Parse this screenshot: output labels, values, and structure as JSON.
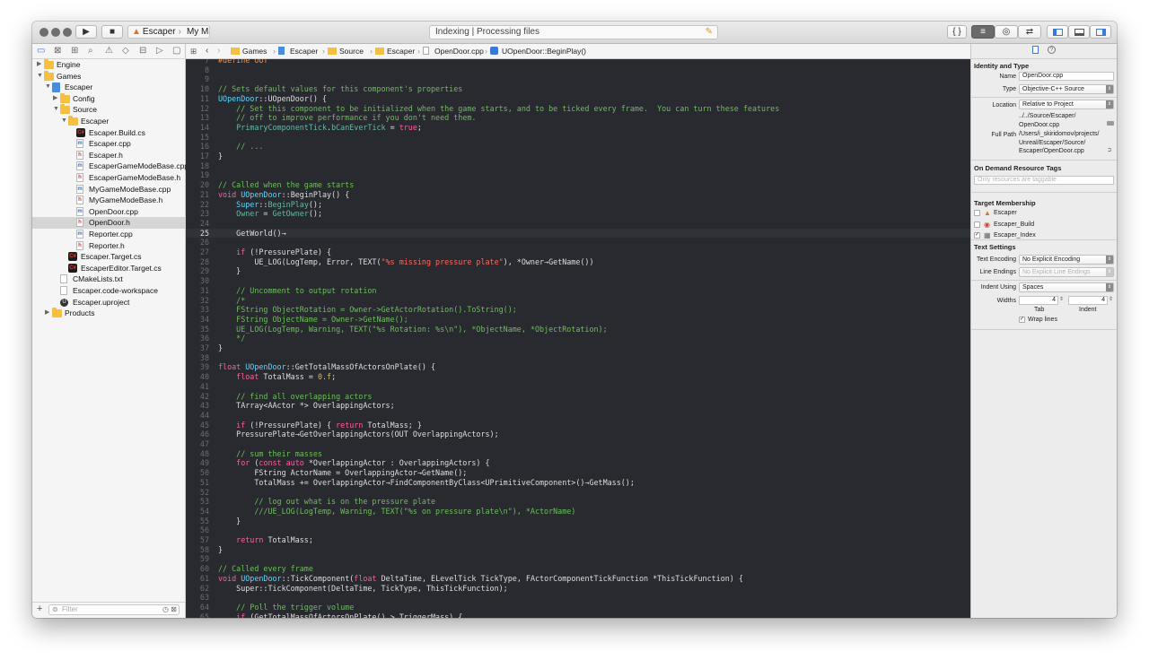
{
  "toolbar": {
    "scheme": "Escaper",
    "destination": "My Mac",
    "activity": "Indexing | Processing files"
  },
  "navigator": {
    "filter_placeholder": "Filter",
    "items": [
      {
        "label": "Engine",
        "depth": 0,
        "kind": "folder",
        "disclosure": "▶"
      },
      {
        "label": "Games",
        "depth": 0,
        "kind": "folder",
        "disclosure": "▼"
      },
      {
        "label": "Escaper",
        "depth": 1,
        "kind": "project",
        "disclosure": "▼"
      },
      {
        "label": "Config",
        "depth": 2,
        "kind": "folder",
        "disclosure": "▶"
      },
      {
        "label": "Source",
        "depth": 2,
        "kind": "folder",
        "disclosure": "▼"
      },
      {
        "label": "Escaper",
        "depth": 3,
        "kind": "folder",
        "disclosure": "▼"
      },
      {
        "label": "Escaper.Build.cs",
        "depth": 4,
        "kind": "badge",
        "badge": "C#"
      },
      {
        "label": "Escaper.cpp",
        "depth": 4,
        "kind": "doc",
        "type": "m",
        "letter": "m"
      },
      {
        "label": "Escaper.h",
        "depth": 4,
        "kind": "doc",
        "type": "h",
        "letter": "h"
      },
      {
        "label": "EscaperGameModeBase.cpp",
        "depth": 4,
        "kind": "doc",
        "type": "m",
        "letter": "m"
      },
      {
        "label": "EscaperGameModeBase.h",
        "depth": 4,
        "kind": "doc",
        "type": "h",
        "letter": "h"
      },
      {
        "label": "MyGameModeBase.cpp",
        "depth": 4,
        "kind": "doc",
        "type": "m",
        "letter": "m"
      },
      {
        "label": "MyGameModeBase.h",
        "depth": 4,
        "kind": "doc",
        "type": "h",
        "letter": "h"
      },
      {
        "label": "OpenDoor.cpp",
        "depth": 4,
        "kind": "doc",
        "type": "m",
        "letter": "m"
      },
      {
        "label": "OpenDoor.h",
        "depth": 4,
        "kind": "doc",
        "type": "h",
        "letter": "h",
        "selected": true
      },
      {
        "label": "Reporter.cpp",
        "depth": 4,
        "kind": "doc",
        "type": "m",
        "letter": "m"
      },
      {
        "label": "Reporter.h",
        "depth": 4,
        "kind": "doc",
        "type": "h",
        "letter": "h"
      },
      {
        "label": "Escaper.Target.cs",
        "depth": 3,
        "kind": "badge",
        "badge": "C#"
      },
      {
        "label": "EscaperEditor.Target.cs",
        "depth": 3,
        "kind": "badge",
        "badge": "C#"
      },
      {
        "label": "CMakeLists.txt",
        "depth": 2,
        "kind": "doc",
        "type": "g",
        "letter": ""
      },
      {
        "label": "Escaper.code-workspace",
        "depth": 2,
        "kind": "doc",
        "type": "g",
        "letter": ""
      },
      {
        "label": "Escaper.uproject",
        "depth": 2,
        "kind": "uproj"
      },
      {
        "label": "Products",
        "depth": 1,
        "kind": "folder",
        "disclosure": "▶"
      }
    ]
  },
  "jumpbar": [
    "Games",
    "Escaper",
    "Source",
    "Escaper",
    "OpenDoor.cpp",
    "UOpenDoor::BeginPlay()"
  ],
  "colors": {
    "comment": "#6bbf59",
    "keyword": "#fc5fa3",
    "type": "#5dd8ff",
    "macro": "#fd8f3f",
    "string": "#fc6a5d",
    "func": "#67b7a4",
    "plain": "#dfdfe0",
    "number": "#d0bf69",
    "linenum": "#6c6c73"
  },
  "code": [
    {
      "n": "7",
      "t": [
        [
          "#define OUT",
          "macro"
        ]
      ]
    },
    {
      "n": "8",
      "t": []
    },
    {
      "n": "9",
      "t": []
    },
    {
      "n": "10",
      "t": [
        [
          "// Sets default values for this component's properties",
          "comment"
        ]
      ]
    },
    {
      "n": "11",
      "t": [
        [
          "UOpenDoor",
          "type"
        ],
        [
          "::",
          "plain"
        ],
        [
          "UOpenDoor() {",
          "plain"
        ]
      ]
    },
    {
      "n": "12",
      "t": [
        [
          "    // Set this component to be initialized when the game starts, and to be ticked every frame.  You can turn these features",
          "comment"
        ]
      ]
    },
    {
      "n": "13",
      "t": [
        [
          "    // off to improve performance if you don't need them.",
          "comment"
        ]
      ]
    },
    {
      "n": "14",
      "t": [
        [
          "    PrimaryComponentTick",
          "func"
        ],
        [
          ".",
          "plain"
        ],
        [
          "bCanEverTick",
          "func"
        ],
        [
          " = ",
          "plain"
        ],
        [
          "true",
          "keyword"
        ],
        [
          ";",
          "plain"
        ]
      ]
    },
    {
      "n": "15",
      "t": []
    },
    {
      "n": "16",
      "t": [
        [
          "    // ...",
          "comment"
        ]
      ]
    },
    {
      "n": "17",
      "t": [
        [
          "}",
          "plain"
        ]
      ]
    },
    {
      "n": "18",
      "t": []
    },
    {
      "n": "19",
      "t": []
    },
    {
      "n": "20",
      "t": [
        [
          "// Called when the game starts",
          "comment"
        ]
      ]
    },
    {
      "n": "21",
      "t": [
        [
          "void ",
          "keyword"
        ],
        [
          "UOpenDoor",
          "type"
        ],
        [
          "::",
          "plain"
        ],
        [
          "BeginPlay() {",
          "plain"
        ]
      ]
    },
    {
      "n": "22",
      "t": [
        [
          "    Super",
          "type"
        ],
        [
          "::",
          "plain"
        ],
        [
          "BeginPlay",
          "func"
        ],
        [
          "();",
          "plain"
        ]
      ]
    },
    {
      "n": "23",
      "t": [
        [
          "    Owner",
          "func"
        ],
        [
          " = ",
          "plain"
        ],
        [
          "GetOwner",
          "func"
        ],
        [
          "();",
          "plain"
        ]
      ]
    },
    {
      "n": "24",
      "t": []
    },
    {
      "n": "25",
      "t": [
        [
          "    GetWorld()→",
          "plain"
        ]
      ],
      "current": true
    },
    {
      "n": "26",
      "t": []
    },
    {
      "n": "27",
      "t": [
        [
          "    if ",
          "keyword"
        ],
        [
          "(!PressurePlate) {",
          "plain"
        ]
      ]
    },
    {
      "n": "28",
      "t": [
        [
          "        UE_LOG(LogTemp, Error, TEXT(",
          "plain"
        ],
        [
          "\"%s missing pressure plate\"",
          "string"
        ],
        [
          "), *Owner→GetName())",
          "plain"
        ]
      ]
    },
    {
      "n": "29",
      "t": [
        [
          "    }",
          "plain"
        ]
      ]
    },
    {
      "n": "30",
      "t": []
    },
    {
      "n": "31",
      "t": [
        [
          "    // Uncomment to output rotation",
          "comment"
        ]
      ]
    },
    {
      "n": "32",
      "t": [
        [
          "    /*",
          "comment"
        ]
      ]
    },
    {
      "n": "33",
      "t": [
        [
          "    FString ObjectRotation = Owner->GetActorRotation().ToString();",
          "comment"
        ]
      ]
    },
    {
      "n": "34",
      "t": [
        [
          "    FString ObjectName = Owner->GetName();",
          "comment"
        ]
      ]
    },
    {
      "n": "35",
      "t": [
        [
          "    UE_LOG(LogTemp, Warning, TEXT(\"%s Rotation: %s\\n\"), *ObjectName, *ObjectRotation);",
          "comment"
        ]
      ]
    },
    {
      "n": "36",
      "t": [
        [
          "    */",
          "comment"
        ]
      ]
    },
    {
      "n": "37",
      "t": [
        [
          "}",
          "plain"
        ]
      ]
    },
    {
      "n": "38",
      "t": []
    },
    {
      "n": "39",
      "t": [
        [
          "float ",
          "keyword"
        ],
        [
          "UOpenDoor",
          "type"
        ],
        [
          "::",
          "plain"
        ],
        [
          "GetTotalMassOfActorsOnPlate() {",
          "plain"
        ]
      ]
    },
    {
      "n": "40",
      "t": [
        [
          "    float ",
          "keyword"
        ],
        [
          "TotalMass = ",
          "plain"
        ],
        [
          "0.f",
          "number"
        ],
        [
          ";",
          "plain"
        ]
      ]
    },
    {
      "n": "41",
      "t": []
    },
    {
      "n": "42",
      "t": [
        [
          "    // find all overlapping actors",
          "comment"
        ]
      ]
    },
    {
      "n": "43",
      "t": [
        [
          "    TArray<AActor *> OverlappingActors;",
          "plain"
        ]
      ]
    },
    {
      "n": "44",
      "t": []
    },
    {
      "n": "45",
      "t": [
        [
          "    if ",
          "keyword"
        ],
        [
          "(!PressurePlate) { ",
          "plain"
        ],
        [
          "return ",
          "keyword"
        ],
        [
          "TotalMass; }",
          "plain"
        ]
      ]
    },
    {
      "n": "46",
      "t": [
        [
          "    PressurePlate→GetOverlappingActors(OUT OverlappingActors);",
          "plain"
        ]
      ]
    },
    {
      "n": "47",
      "t": []
    },
    {
      "n": "48",
      "t": [
        [
          "    // sum their masses",
          "comment"
        ]
      ]
    },
    {
      "n": "49",
      "t": [
        [
          "    for ",
          "keyword"
        ],
        [
          "(",
          "plain"
        ],
        [
          "const auto ",
          "keyword"
        ],
        [
          "*OverlappingActor : OverlappingActors) {",
          "plain"
        ]
      ]
    },
    {
      "n": "50",
      "t": [
        [
          "        FString ActorName = OverlappingActor→GetName();",
          "plain"
        ]
      ]
    },
    {
      "n": "51",
      "t": [
        [
          "        TotalMass += OverlappingActor→FindComponentByClass<UPrimitiveComponent>()→GetMass();",
          "plain"
        ]
      ]
    },
    {
      "n": "52",
      "t": []
    },
    {
      "n": "53",
      "t": [
        [
          "        // log out what is on the pressure plate",
          "comment"
        ]
      ]
    },
    {
      "n": "54",
      "t": [
        [
          "        ///UE_LOG(LogTemp, Warning, TEXT(\"%s on pressure plate\\n\"), *ActorName)",
          "comment"
        ]
      ]
    },
    {
      "n": "55",
      "t": [
        [
          "    }",
          "plain"
        ]
      ]
    },
    {
      "n": "56",
      "t": []
    },
    {
      "n": "57",
      "t": [
        [
          "    return ",
          "keyword"
        ],
        [
          "TotalMass;",
          "plain"
        ]
      ]
    },
    {
      "n": "58",
      "t": [
        [
          "}",
          "plain"
        ]
      ]
    },
    {
      "n": "59",
      "t": []
    },
    {
      "n": "60",
      "t": [
        [
          "// Called every frame",
          "comment"
        ]
      ]
    },
    {
      "n": "61",
      "t": [
        [
          "void ",
          "keyword"
        ],
        [
          "UOpenDoor",
          "type"
        ],
        [
          "::",
          "plain"
        ],
        [
          "TickComponent(",
          "plain"
        ],
        [
          "float ",
          "keyword"
        ],
        [
          "DeltaTime, ELevelTick TickType, FActorComponentTickFunction *ThisTickFunction) {",
          "plain"
        ]
      ]
    },
    {
      "n": "62",
      "t": [
        [
          "    Super::TickComponent(DeltaTime, TickType, ThisTickFunction);",
          "plain"
        ]
      ]
    },
    {
      "n": "63",
      "t": []
    },
    {
      "n": "64",
      "t": [
        [
          "    // Poll the trigger volume",
          "comment"
        ]
      ]
    },
    {
      "n": "65",
      "t": [
        [
          "    if ",
          "keyword"
        ],
        [
          "(GetTotalMassOfActorsOnPlate() > TriggerMass) {",
          "plain"
        ]
      ]
    }
  ],
  "inspector": {
    "identity_title": "Identity and Type",
    "name_label": "Name",
    "name_value": "OpenDoor.cpp",
    "type_label": "Type",
    "type_value": "Objective-C++ Source",
    "location_label": "Location",
    "location_value": "Relative to Project",
    "location_path": "../../Source/Escaper/\nOpenDoor.cpp",
    "fullpath_label": "Full Path",
    "fullpath_value": "/Users/i_skiridomov/projects/\nUnreal/Escaper/Source/\nEscaper/OpenDoor.cpp",
    "odr_title": "On Demand Resource Tags",
    "odr_placeholder": "Only resources are taggable",
    "target_title": "Target Membership",
    "targets": [
      {
        "label": "Escaper",
        "checked": false
      },
      {
        "label": "Escaper_Build",
        "checked": false
      },
      {
        "label": "Escaper_Index",
        "checked": true
      }
    ],
    "text_title": "Text Settings",
    "encoding_label": "Text Encoding",
    "encoding_value": "No Explicit Encoding",
    "endings_label": "Line Endings",
    "endings_value": "No Explicit Line Endings",
    "indent_label": "Indent Using",
    "indent_value": "Spaces",
    "widths_label": "Widths",
    "tab_value": "4",
    "indent_width_value": "4",
    "tab_label": "Tab",
    "indent_sub_label": "Indent",
    "wrap_label": "Wrap lines",
    "wrap_checked": true
  }
}
